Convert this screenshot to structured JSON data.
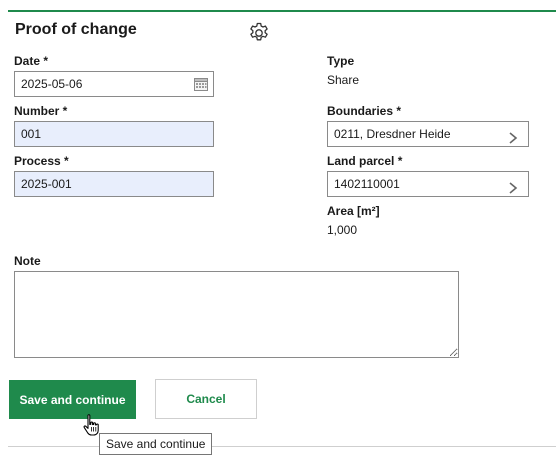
{
  "panel": {
    "title": "Proof of change",
    "settings_icon": "gear-icon"
  },
  "form": {
    "date": {
      "label": "Date *",
      "value": "2025-05-06",
      "icon": "calendar-icon"
    },
    "number": {
      "label": "Number *",
      "value": "001"
    },
    "process": {
      "label": "Process *",
      "value": "2025-001"
    },
    "type": {
      "label": "Type",
      "value": "Share"
    },
    "boundaries": {
      "label": "Boundaries *",
      "value": "0211, Dresdner Heide",
      "icon": "chevron-right-icon"
    },
    "land_parcel": {
      "label": "Land parcel *",
      "value": "1402110001",
      "icon": "chevron-right-icon"
    },
    "area": {
      "label": "Area [m²]",
      "value": "1,000"
    },
    "note": {
      "label": "Note",
      "value": ""
    }
  },
  "actions": {
    "save_label": "Save and continue",
    "cancel_label": "Cancel"
  },
  "tooltip": {
    "text": "Save and continue"
  },
  "colors": {
    "accent": "#1f8a4c",
    "filled_field": "#e8eefc",
    "border": "#8a8a8a"
  }
}
